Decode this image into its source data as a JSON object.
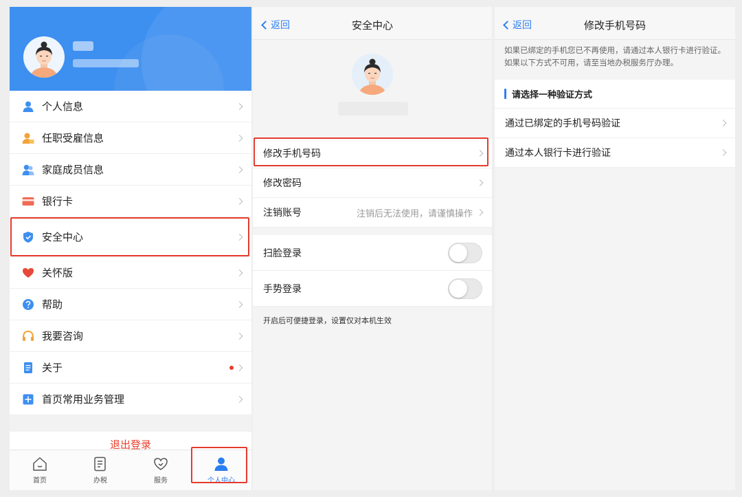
{
  "personal_center": {
    "menu": [
      {
        "label": "个人信息",
        "icon": "person-icon"
      },
      {
        "label": "任职受雇信息",
        "icon": "employment-icon"
      },
      {
        "label": "家庭成员信息",
        "icon": "family-icon"
      },
      {
        "label": "银行卡",
        "icon": "bank-card-icon"
      },
      {
        "label": "安全中心",
        "icon": "shield-icon"
      },
      {
        "label": "关怀版",
        "icon": "heart-icon"
      },
      {
        "label": "帮助",
        "icon": "help-icon"
      },
      {
        "label": "我要咨询",
        "icon": "headset-icon"
      },
      {
        "label": "关于",
        "icon": "document-icon"
      },
      {
        "label": "首页常用业务管理",
        "icon": "plus-square-icon"
      }
    ],
    "logout_label": "退出登录",
    "tabs": [
      {
        "label": "首页",
        "icon": "home-icon"
      },
      {
        "label": "办税",
        "icon": "tax-icon"
      },
      {
        "label": "服务",
        "icon": "service-icon"
      },
      {
        "label": "个人中心",
        "icon": "user-icon"
      }
    ],
    "active_tab": "个人中心"
  },
  "security_center": {
    "back_label": "返回",
    "title": "安全中心",
    "rows": [
      {
        "label": "修改手机号码",
        "value": ""
      },
      {
        "label": "修改密码",
        "value": ""
      },
      {
        "label": "注销账号",
        "value": "注销后无法使用，请谨慎操作"
      }
    ],
    "toggles": [
      {
        "label": "扫脸登录",
        "on": false
      },
      {
        "label": "手势登录",
        "on": false
      }
    ],
    "toggle_note": "开启后可便捷登录，设置仅对本机生效"
  },
  "change_phone": {
    "back_label": "返回",
    "title": "修改手机号码",
    "notice": "如果已绑定的手机您已不再使用，请通过本人银行卡进行验证。如果以下方式不可用，请至当地办税服务厅办理。",
    "section_title": "请选择一种验证方式",
    "options": [
      {
        "label": "通过已绑定的手机号码验证"
      },
      {
        "label": "通过本人银行卡进行验证"
      }
    ]
  },
  "colors": {
    "primary_blue": "#3d8ff0",
    "link_blue": "#2f7ff1",
    "highlight_red": "#e53a2c",
    "logout_red": "#e8412f"
  }
}
